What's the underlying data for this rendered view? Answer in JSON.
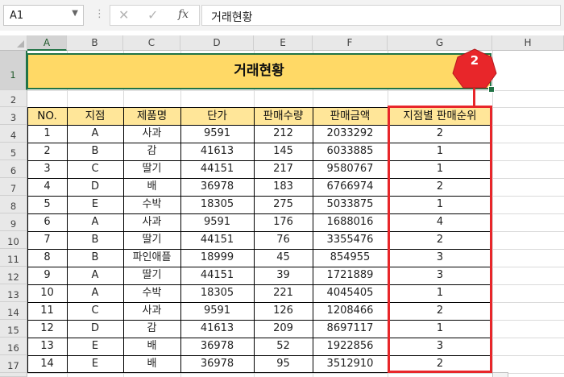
{
  "formula_bar": {
    "cell_ref": "A1",
    "dropdown_icon": "chevron-down-icon",
    "cancel_icon": "✕",
    "confirm_icon": "✓",
    "function_icon": "fx",
    "formula_value": "거래현황"
  },
  "columns": [
    "A",
    "B",
    "C",
    "D",
    "E",
    "F",
    "G",
    "H"
  ],
  "rows": [
    "1",
    "2",
    "3",
    "4",
    "5",
    "6",
    "7",
    "8",
    "9",
    "10",
    "11",
    "12",
    "13",
    "14",
    "15",
    "16",
    "17"
  ],
  "sheet": {
    "title": "거래현황",
    "table": {
      "headers": [
        "NO.",
        "지점",
        "제품명",
        "단가",
        "판매수량",
        "판매금액",
        "지점별 판매순위"
      ],
      "rows": [
        [
          "1",
          "A",
          "사과",
          "9591",
          "212",
          "2033292",
          "2"
        ],
        [
          "2",
          "B",
          "감",
          "41613",
          "145",
          "6033885",
          "1"
        ],
        [
          "3",
          "C",
          "딸기",
          "44151",
          "217",
          "9580767",
          "1"
        ],
        [
          "4",
          "D",
          "배",
          "36978",
          "183",
          "6766974",
          "2"
        ],
        [
          "5",
          "E",
          "수박",
          "18305",
          "275",
          "5033875",
          "1"
        ],
        [
          "6",
          "A",
          "사과",
          "9591",
          "176",
          "1688016",
          "4"
        ],
        [
          "7",
          "B",
          "딸기",
          "44151",
          "76",
          "3355476",
          "2"
        ],
        [
          "8",
          "B",
          "파인애플",
          "18999",
          "45",
          "854955",
          "3"
        ],
        [
          "9",
          "A",
          "딸기",
          "44151",
          "39",
          "1721889",
          "3"
        ],
        [
          "10",
          "A",
          "수박",
          "18305",
          "221",
          "4045405",
          "1"
        ],
        [
          "11",
          "C",
          "사과",
          "9591",
          "126",
          "1208466",
          "2"
        ],
        [
          "12",
          "D",
          "감",
          "41613",
          "209",
          "8697117",
          "1"
        ],
        [
          "13",
          "E",
          "배",
          "36978",
          "52",
          "1922856",
          "3"
        ],
        [
          "14",
          "E",
          "배",
          "36978",
          "95",
          "3512910",
          "2"
        ]
      ]
    }
  },
  "annotation": {
    "step_number": "2",
    "color": "#e8262a"
  },
  "colors": {
    "title_fill": "#ffd966",
    "header_fill": "#ffe699",
    "selection": "#217346"
  }
}
